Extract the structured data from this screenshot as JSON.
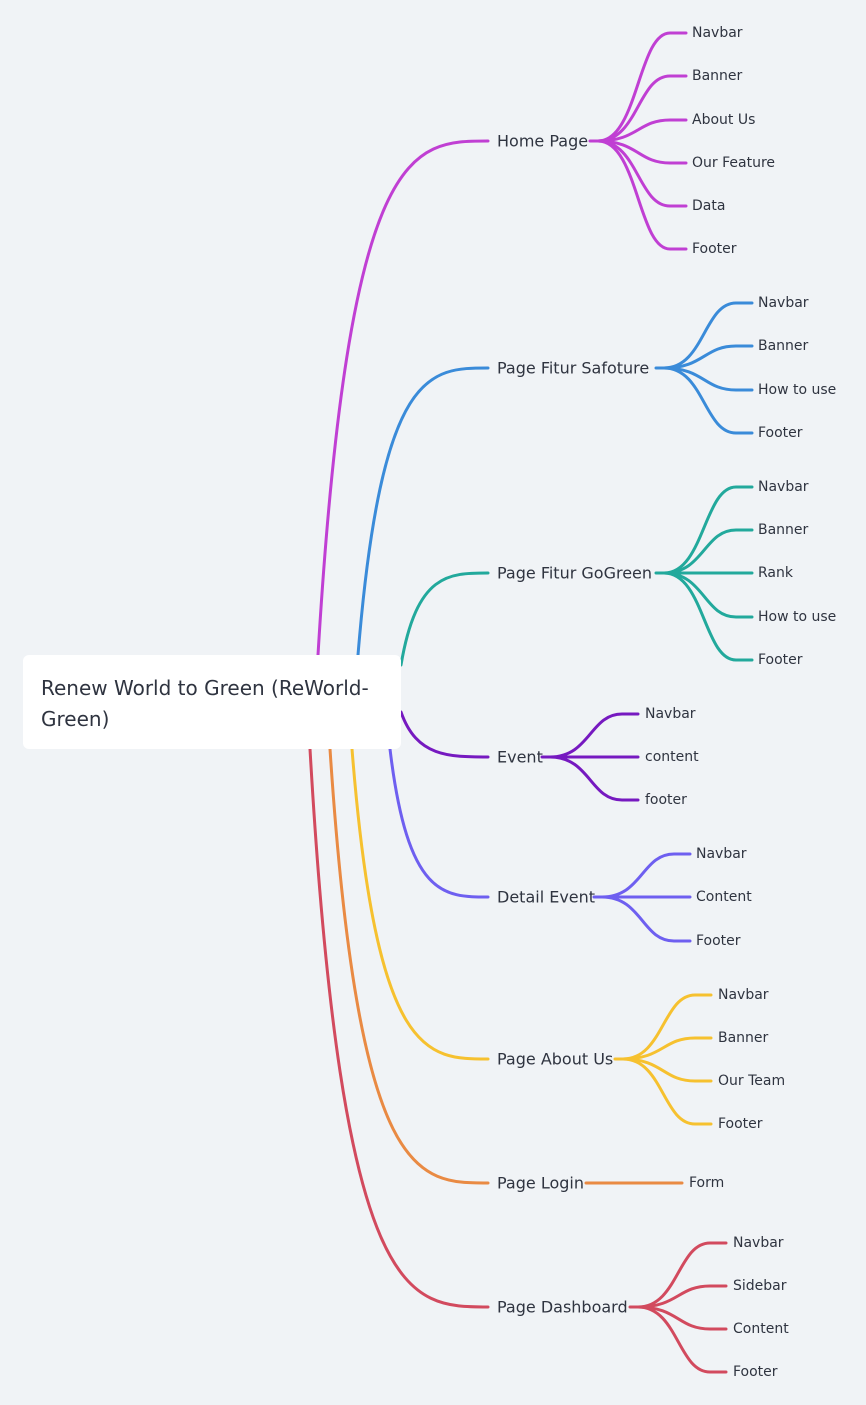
{
  "root": {
    "label": "Renew World to Green (ReWorld-Green)"
  },
  "branches": [
    {
      "label": "Home Page",
      "color": "#c03fd3",
      "children": [
        "Navbar",
        "Banner",
        "About Us",
        "Our Feature",
        "Data",
        "Footer"
      ]
    },
    {
      "label": "Page Fitur Safoture",
      "color": "#3a8bd9",
      "children": [
        "Navbar",
        "Banner",
        "How to use",
        "Footer"
      ]
    },
    {
      "label": "Page Fitur GoGreen",
      "color": "#22a99c",
      "children": [
        "Navbar",
        "Banner",
        "Rank",
        "How to use",
        "Footer"
      ]
    },
    {
      "label": "Event",
      "color": "#7619c0",
      "children": [
        "Navbar",
        "content",
        "footer"
      ]
    },
    {
      "label": "Detail Event",
      "color": "#6e5ff0",
      "children": [
        "Navbar",
        "Content",
        "Footer"
      ]
    },
    {
      "label": "Page About Us",
      "color": "#f6c12f",
      "children": [
        "Navbar",
        "Banner",
        "Our Team",
        "Footer"
      ]
    },
    {
      "label": "Page Login",
      "color": "#e98a43",
      "children": [
        "Form"
      ]
    },
    {
      "label": "Page Dashboard",
      "color": "#d24a5e",
      "children": [
        "Navbar",
        "Sidebar",
        "Content",
        "Footer"
      ]
    }
  ]
}
